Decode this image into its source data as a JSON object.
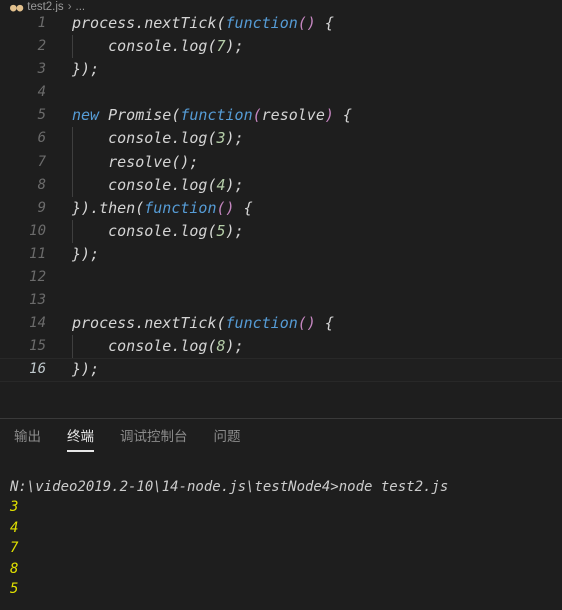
{
  "breadcrumb": {
    "file_icon": "js-file-icon",
    "file_name": "test2.js",
    "separator": "›",
    "tail": "..."
  },
  "editor": {
    "language": "javascript",
    "current_line": 16,
    "lines": [
      {
        "n": "1",
        "guide": false,
        "tokens": [
          {
            "t": "process.nextTick",
            "c": "tok-plain"
          },
          {
            "t": "(",
            "c": "tok-paren1"
          },
          {
            "t": "function",
            "c": "tok-kw"
          },
          {
            "t": "()",
            "c": "tok-paren2"
          },
          {
            "t": " {",
            "c": "tok-plain"
          }
        ]
      },
      {
        "n": "2",
        "guide": true,
        "tokens": [
          {
            "t": "    console.log",
            "c": "tok-plain"
          },
          {
            "t": "(",
            "c": "tok-paren1"
          },
          {
            "t": "7",
            "c": "tok-num"
          },
          {
            "t": ")",
            "c": "tok-paren1"
          },
          {
            "t": ";",
            "c": "tok-plain"
          }
        ]
      },
      {
        "n": "3",
        "guide": false,
        "tokens": [
          {
            "t": "}",
            "c": "tok-plain"
          },
          {
            "t": ")",
            "c": "tok-paren1"
          },
          {
            "t": ";",
            "c": "tok-plain"
          }
        ]
      },
      {
        "n": "4",
        "guide": false,
        "tokens": []
      },
      {
        "n": "5",
        "guide": false,
        "tokens": [
          {
            "t": "new",
            "c": "tok-kw"
          },
          {
            "t": " Promise",
            "c": "tok-plain"
          },
          {
            "t": "(",
            "c": "tok-paren1"
          },
          {
            "t": "function",
            "c": "tok-kw"
          },
          {
            "t": "(",
            "c": "tok-paren2"
          },
          {
            "t": "resolve",
            "c": "tok-plain"
          },
          {
            "t": ")",
            "c": "tok-paren2"
          },
          {
            "t": " {",
            "c": "tok-plain"
          }
        ]
      },
      {
        "n": "6",
        "guide": true,
        "tokens": [
          {
            "t": "    console.log",
            "c": "tok-plain"
          },
          {
            "t": "(",
            "c": "tok-paren1"
          },
          {
            "t": "3",
            "c": "tok-num"
          },
          {
            "t": ")",
            "c": "tok-paren1"
          },
          {
            "t": ";",
            "c": "tok-plain"
          }
        ]
      },
      {
        "n": "7",
        "guide": true,
        "tokens": [
          {
            "t": "    resolve",
            "c": "tok-plain"
          },
          {
            "t": "()",
            "c": "tok-paren1"
          },
          {
            "t": ";",
            "c": "tok-plain"
          }
        ]
      },
      {
        "n": "8",
        "guide": true,
        "tokens": [
          {
            "t": "    console.log",
            "c": "tok-plain"
          },
          {
            "t": "(",
            "c": "tok-paren1"
          },
          {
            "t": "4",
            "c": "tok-num"
          },
          {
            "t": ")",
            "c": "tok-paren1"
          },
          {
            "t": ";",
            "c": "tok-plain"
          }
        ]
      },
      {
        "n": "9",
        "guide": false,
        "tokens": [
          {
            "t": "}",
            "c": "tok-plain"
          },
          {
            "t": ")",
            "c": "tok-paren1"
          },
          {
            "t": ".then",
            "c": "tok-plain"
          },
          {
            "t": "(",
            "c": "tok-paren1"
          },
          {
            "t": "function",
            "c": "tok-kw"
          },
          {
            "t": "()",
            "c": "tok-paren2"
          },
          {
            "t": " {",
            "c": "tok-plain"
          }
        ]
      },
      {
        "n": "10",
        "guide": true,
        "tokens": [
          {
            "t": "    console.log",
            "c": "tok-plain"
          },
          {
            "t": "(",
            "c": "tok-paren1"
          },
          {
            "t": "5",
            "c": "tok-num"
          },
          {
            "t": ")",
            "c": "tok-paren1"
          },
          {
            "t": ";",
            "c": "tok-plain"
          }
        ]
      },
      {
        "n": "11",
        "guide": false,
        "tokens": [
          {
            "t": "}",
            "c": "tok-plain"
          },
          {
            "t": ")",
            "c": "tok-paren1"
          },
          {
            "t": ";",
            "c": "tok-plain"
          }
        ]
      },
      {
        "n": "12",
        "guide": false,
        "tokens": []
      },
      {
        "n": "13",
        "guide": false,
        "tokens": []
      },
      {
        "n": "14",
        "guide": false,
        "tokens": [
          {
            "t": "process.nextTick",
            "c": "tok-plain"
          },
          {
            "t": "(",
            "c": "tok-paren1"
          },
          {
            "t": "function",
            "c": "tok-kw"
          },
          {
            "t": "()",
            "c": "tok-paren2"
          },
          {
            "t": " {",
            "c": "tok-plain"
          }
        ]
      },
      {
        "n": "15",
        "guide": true,
        "tokens": [
          {
            "t": "    console.log",
            "c": "tok-plain"
          },
          {
            "t": "(",
            "c": "tok-paren1"
          },
          {
            "t": "8",
            "c": "tok-num"
          },
          {
            "t": ")",
            "c": "tok-paren1"
          },
          {
            "t": ";",
            "c": "tok-plain"
          }
        ]
      },
      {
        "n": "16",
        "guide": false,
        "tokens": [
          {
            "t": "}",
            "c": "tok-plain"
          },
          {
            "t": ")",
            "c": "tok-paren1"
          },
          {
            "t": ";",
            "c": "tok-plain"
          }
        ]
      }
    ]
  },
  "panel": {
    "tabs": [
      {
        "label": "输出",
        "active": false
      },
      {
        "label": "终端",
        "active": true
      },
      {
        "label": "调试控制台",
        "active": false
      },
      {
        "label": "问题",
        "active": false
      }
    ],
    "terminal": {
      "prompt_line": "N:\\video2019.2-10\\14-node.js\\testNode4>node test2.js",
      "output": [
        "3",
        "4",
        "7",
        "8",
        "5"
      ]
    }
  },
  "colors": {
    "editor_background": "#1e1e1e",
    "panel_background": "#1e1e1e",
    "keyword": "#569cd6",
    "number": "#b5cea8",
    "plain_text": "#d4d4d4",
    "line_number": "#6b6b6b",
    "line_number_active": "#bfc8cc",
    "terminal_output_yellow": "#e0e000",
    "divider": "#3a3a3a",
    "indent_guide": "#3f3f3f"
  }
}
